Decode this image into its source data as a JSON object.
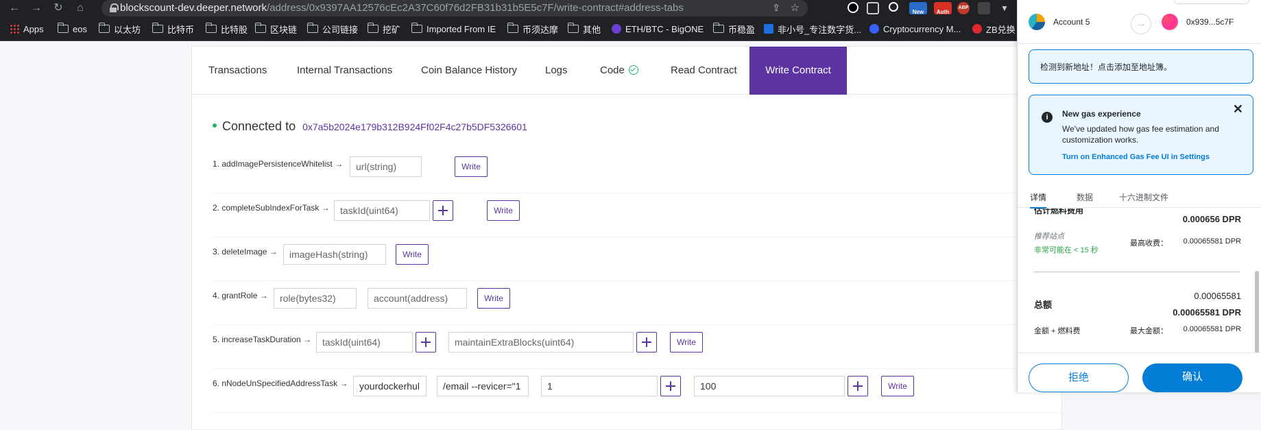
{
  "browser": {
    "url_host": "blockscount-dev.deeper.network",
    "url_path": "/address/0x9397AA12576cEc2A37C60f76d2FB31b31b5E5c7F/write-contract#address-tabs",
    "extension_labels": [
      "New",
      "Auth",
      "ABP"
    ]
  },
  "bookmarks": [
    {
      "label": "Apps",
      "icon": "apps-icon"
    },
    {
      "label": "eos",
      "icon": "folder-icon"
    },
    {
      "label": "以太坊",
      "icon": "folder-icon"
    },
    {
      "label": "比特币",
      "icon": "folder-icon"
    },
    {
      "label": "比特股",
      "icon": "folder-icon"
    },
    {
      "label": "区块链",
      "icon": "folder-icon"
    },
    {
      "label": "公司链接",
      "icon": "folder-icon"
    },
    {
      "label": "挖矿",
      "icon": "folder-icon"
    },
    {
      "label": "Imported From IE",
      "icon": "folder-icon"
    },
    {
      "label": "币须达摩",
      "icon": "folder-icon"
    },
    {
      "label": "其他",
      "icon": "folder-icon"
    },
    {
      "label": "ETH/BTC - BigONE",
      "icon": "bigone-icon"
    },
    {
      "label": "币稳盈",
      "icon": "folder-icon"
    },
    {
      "label": "非小号_专注数字货...",
      "icon": "feixiaohao-icon"
    },
    {
      "label": "Cryptocurrency M...",
      "icon": "coinmarketcap-icon"
    },
    {
      "label": "ZB兑换",
      "icon": "zb-icon"
    }
  ],
  "tabs": {
    "transactions": "Transactions",
    "internal": "Internal Transactions",
    "coin_balance": "Coin Balance History",
    "logs": "Logs",
    "code": "Code",
    "read": "Read Contract",
    "write": "Write Contract"
  },
  "connection": {
    "label": "Connected to",
    "address": "0x7a5b2024e179b312B924Ff02F4c27b5DF5326601"
  },
  "write_label": "Write",
  "functions": [
    {
      "name": "1. addImagePersistenceWhitelist →",
      "inputs": [
        "url(string)"
      ]
    },
    {
      "name": "2. completeSubIndexForTask →",
      "inputs": [
        "taskId(uint64)"
      ]
    },
    {
      "name": "3. deleteImage →",
      "inputs": [
        "imageHash(string)"
      ]
    },
    {
      "name": "4. grantRole →",
      "inputs": [
        "role(bytes32)",
        "account(address)"
      ]
    },
    {
      "name": "5. increaseTaskDuration →",
      "inputs": [
        "taskId(uint64)",
        "maintainExtraBlocks(uint64)"
      ]
    },
    {
      "name": "6. nNodeUnSpecifiedAddressTask →",
      "values": [
        "yourdockerhul",
        "/email --revicer=\"1",
        "1",
        "100"
      ]
    }
  ],
  "metamask": {
    "from_account": "Account 5",
    "to_account": "0x939...5c7F",
    "new_address_notice": "检测到新地址！点击添加至地址簿。",
    "gas_notice": {
      "title": "New gas experience",
      "body_line1": "We've updated how gas fee estimation and",
      "body_line2": "customization works.",
      "link": "Turn on Enhanced Gas Fee UI in Settings"
    },
    "tabs": [
      "详情",
      "数据",
      "十六进制文件"
    ],
    "gas_fee_cut": "估计燃料费用",
    "gas_fee": "0.000656 DPR",
    "suggested_site": "推荐站点",
    "speed": "非常可能在 < 15 秒",
    "max_fee_label": "最高收费：",
    "max_fee": "0.00065581 DPR",
    "total_label": "总额",
    "total_small": "0.00065581",
    "total": "0.00065581 DPR",
    "amount_gas_label": "金额 + 燃料费",
    "max_amount_label": "最大金额：",
    "max_amount": "0.00065581 DPR",
    "reject": "拒绝",
    "confirm": "确认"
  }
}
